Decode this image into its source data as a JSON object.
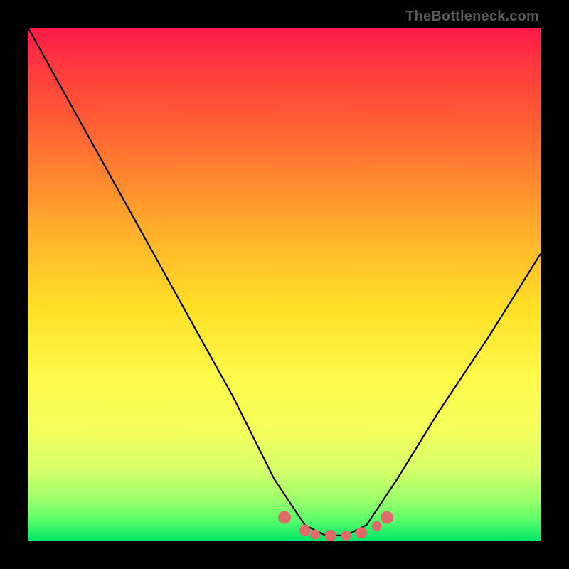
{
  "watermark": "TheBottleneck.com",
  "chart_data": {
    "type": "line",
    "title": "",
    "xlabel": "",
    "ylabel": "",
    "xlim": [
      0,
      1
    ],
    "ylim": [
      0,
      1
    ],
    "series": [
      {
        "name": "bottleneck-curve",
        "x": [
          0.0,
          0.1,
          0.2,
          0.3,
          0.4,
          0.48,
          0.54,
          0.58,
          0.62,
          0.66,
          0.72,
          0.8,
          0.9,
          1.0
        ],
        "y": [
          1.0,
          0.82,
          0.64,
          0.46,
          0.28,
          0.12,
          0.03,
          0.01,
          0.01,
          0.03,
          0.12,
          0.25,
          0.4,
          0.56
        ]
      }
    ],
    "markers": {
      "name": "highlight-dots",
      "color": "#e06a6a",
      "x": [
        0.5,
        0.54,
        0.56,
        0.59,
        0.62,
        0.65,
        0.68,
        0.7
      ],
      "y": [
        0.045,
        0.02,
        0.012,
        0.01,
        0.01,
        0.015,
        0.028,
        0.045
      ]
    },
    "background_gradient": {
      "top": "#ff1a4a",
      "bottom": "#00e668"
    }
  }
}
